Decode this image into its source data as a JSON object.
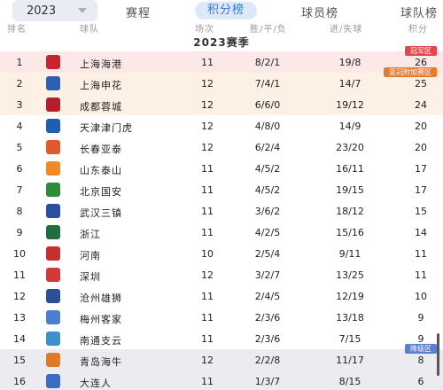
{
  "tabs": {
    "season": "2023",
    "items": [
      "赛程",
      "积分榜",
      "球员榜",
      "球队榜"
    ],
    "active": "积分榜"
  },
  "header": {
    "rank": "排名",
    "team": "球队",
    "played": "场次",
    "wdl": "胜/平/负",
    "goals": "进/失球",
    "points": "积分"
  },
  "season_title": "2023赛季",
  "badges": {
    "champion": "冠军区",
    "acl": "亚冠附加赛区",
    "relegation": "降级区"
  },
  "rows": [
    {
      "rank": "1",
      "team": "上海海港",
      "played": "11",
      "wdl": "8/2/1",
      "goals": "19/8",
      "points": "26",
      "logo_color": "#c8242f"
    },
    {
      "rank": "2",
      "team": "上海申花",
      "played": "12",
      "wdl": "7/4/1",
      "goals": "14/7",
      "points": "25",
      "logo_color": "#2f5fb3"
    },
    {
      "rank": "3",
      "team": "成都蓉城",
      "played": "12",
      "wdl": "6/6/0",
      "goals": "19/12",
      "points": "24",
      "logo_color": "#b3202a"
    },
    {
      "rank": "4",
      "team": "天津津门虎",
      "played": "12",
      "wdl": "4/8/0",
      "goals": "14/9",
      "points": "20",
      "logo_color": "#1e5fb0"
    },
    {
      "rank": "5",
      "team": "长春亚泰",
      "played": "12",
      "wdl": "6/2/4",
      "goals": "23/20",
      "points": "20",
      "logo_color": "#e05a2a"
    },
    {
      "rank": "6",
      "team": "山东泰山",
      "played": "11",
      "wdl": "4/5/2",
      "goals": "16/11",
      "points": "17",
      "logo_color": "#f08a24"
    },
    {
      "rank": "7",
      "team": "北京国安",
      "played": "11",
      "wdl": "4/5/2",
      "goals": "19/15",
      "points": "17",
      "logo_color": "#2e8b3a"
    },
    {
      "rank": "8",
      "team": "武汉三镇",
      "played": "11",
      "wdl": "3/6/2",
      "goals": "18/12",
      "points": "15",
      "logo_color": "#2a4f9e"
    },
    {
      "rank": "9",
      "team": "浙江",
      "played": "11",
      "wdl": "4/2/5",
      "goals": "15/16",
      "points": "14",
      "logo_color": "#1f6e3c"
    },
    {
      "rank": "10",
      "team": "河南",
      "played": "10",
      "wdl": "2/5/4",
      "goals": "9/11",
      "points": "11",
      "logo_color": "#c72e2e"
    },
    {
      "rank": "11",
      "team": "深圳",
      "played": "12",
      "wdl": "3/2/7",
      "goals": "13/25",
      "points": "11",
      "logo_color": "#d23a3a"
    },
    {
      "rank": "12",
      "team": "沧州雄狮",
      "played": "11",
      "wdl": "2/4/5",
      "goals": "12/19",
      "points": "10",
      "logo_color": "#2d4f98"
    },
    {
      "rank": "13",
      "team": "梅州客家",
      "played": "11",
      "wdl": "2/3/6",
      "goals": "13/18",
      "points": "9",
      "logo_color": "#4b7fd1"
    },
    {
      "rank": "14",
      "team": "南通支云",
      "played": "11",
      "wdl": "2/3/6",
      "goals": "7/15",
      "points": "9",
      "logo_color": "#3f8fc9"
    },
    {
      "rank": "15",
      "team": "青岛海牛",
      "played": "12",
      "wdl": "2/2/8",
      "goals": "11/17",
      "points": "8",
      "logo_color": "#e07a2a"
    },
    {
      "rank": "16",
      "team": "大连人",
      "played": "11",
      "wdl": "1/3/7",
      "goals": "8/15",
      "points": "6",
      "logo_color": "#3b6cc2"
    }
  ]
}
